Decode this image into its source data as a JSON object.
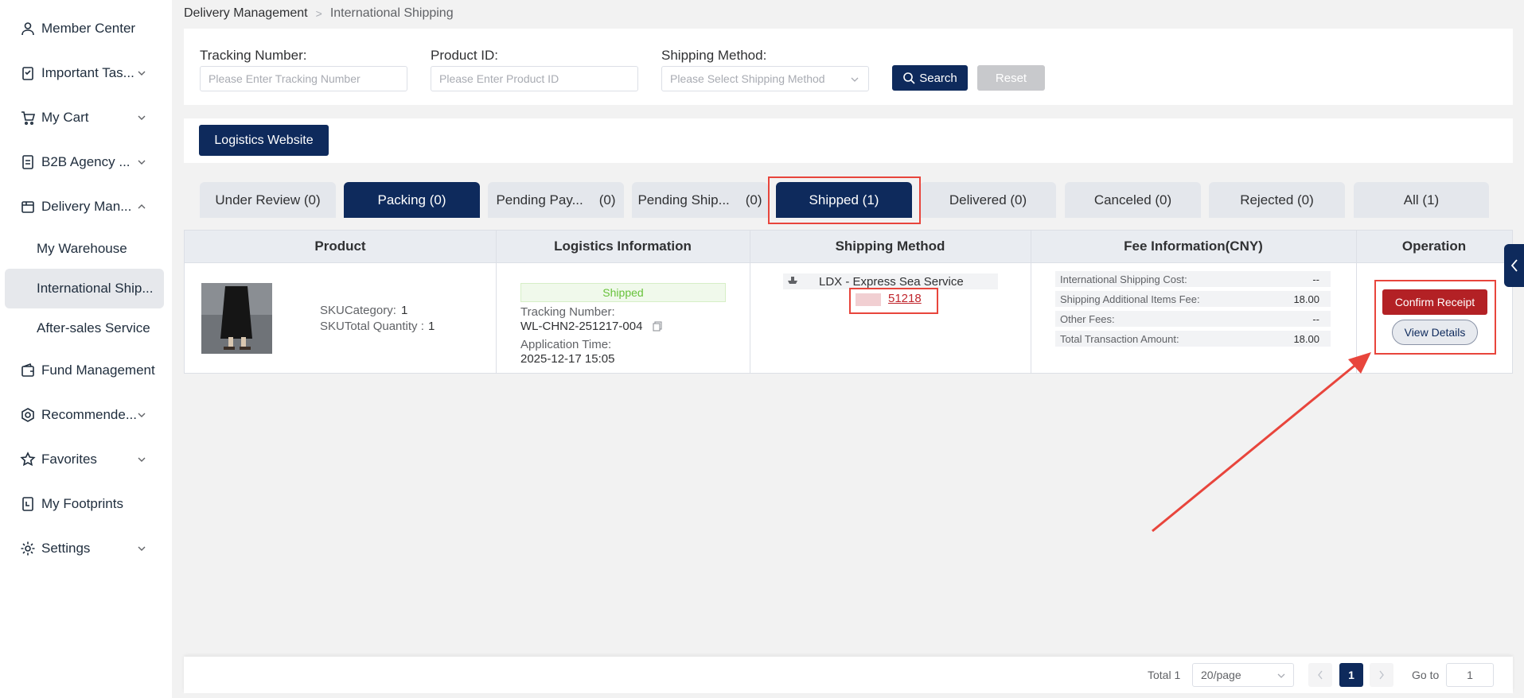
{
  "sidebar": {
    "items": [
      {
        "label": "Member Center",
        "icon": "user-icon"
      },
      {
        "label": "Important Tas...",
        "icon": "clipboard-icon"
      },
      {
        "label": "My Cart",
        "icon": "cart-icon"
      },
      {
        "label": "B2B Agency ...",
        "icon": "document-icon"
      },
      {
        "label": "Delivery Man...",
        "icon": "package-icon"
      },
      {
        "label": "Fund Management",
        "icon": "wallet-icon"
      },
      {
        "label": "Recommende...",
        "icon": "badge-icon"
      },
      {
        "label": "Favorites",
        "icon": "star-icon"
      },
      {
        "label": "My Footprints",
        "icon": "footprints-icon"
      },
      {
        "label": "Settings",
        "icon": "gear-icon"
      }
    ],
    "delivery_sub": [
      "My Warehouse",
      "International Ship...",
      "After-sales Service"
    ]
  },
  "breadcrumb": {
    "root": "Delivery Management",
    "separator": ">",
    "current": "International Shipping"
  },
  "search": {
    "tracking_label": "Tracking Number:",
    "tracking_placeholder": "Please Enter Tracking Number",
    "product_label": "Product ID:",
    "product_placeholder": "Please Enter Product ID",
    "method_label": "Shipping Method:",
    "method_placeholder": "Please Select Shipping Method",
    "search_button": "Search",
    "reset_button": "Reset"
  },
  "logistics_button": "Logistics Website",
  "tabs": [
    {
      "label": "Under Review (0)"
    },
    {
      "label": "Packing (0)"
    },
    {
      "label": "Pending Pay...",
      "count": "(0)"
    },
    {
      "label": "Pending Ship...",
      "count": "(0)"
    },
    {
      "label": "Shipped (1)"
    },
    {
      "label": "Delivered (0)"
    },
    {
      "label": "Canceled (0)"
    },
    {
      "label": "Rejected (0)"
    },
    {
      "label": "All (1)"
    }
  ],
  "table": {
    "headers": [
      "Product",
      "Logistics Information",
      "Shipping Method",
      "Fee Information(CNY)",
      "Operation"
    ],
    "row": {
      "sku_category_label": "SKUCategory:",
      "sku_category_value": "1",
      "sku_total_label": "SKUTotal Quantity :",
      "sku_total_value": "1",
      "status": "Shipped",
      "tracking_label": "Tracking Number:",
      "tracking_number": "WL-CHN2-251217-004",
      "application_label": "Application Time:",
      "application_time": "2025-12-17 15:05",
      "shipping_method": "LDX - Express Sea Service",
      "shipping_link": "51218",
      "fees": [
        {
          "label": "International Shipping Cost:",
          "value": "--"
        },
        {
          "label": "Shipping Additional Items Fee:",
          "value": "18.00"
        },
        {
          "label": "Other Fees:",
          "value": "--"
        },
        {
          "label": "Total Transaction Amount:",
          "value": "18.00"
        }
      ],
      "confirm_button": "Confirm Receipt",
      "view_button": "View Details"
    }
  },
  "pagination": {
    "total": "Total 1",
    "page_size": "20/page",
    "current_page": "1",
    "goto_label": "Go to",
    "goto_value": "1"
  },
  "colors": {
    "primary": "#0e2a5c",
    "danger": "#b32125",
    "highlight": "#e8453c",
    "success": "#67c23a"
  }
}
